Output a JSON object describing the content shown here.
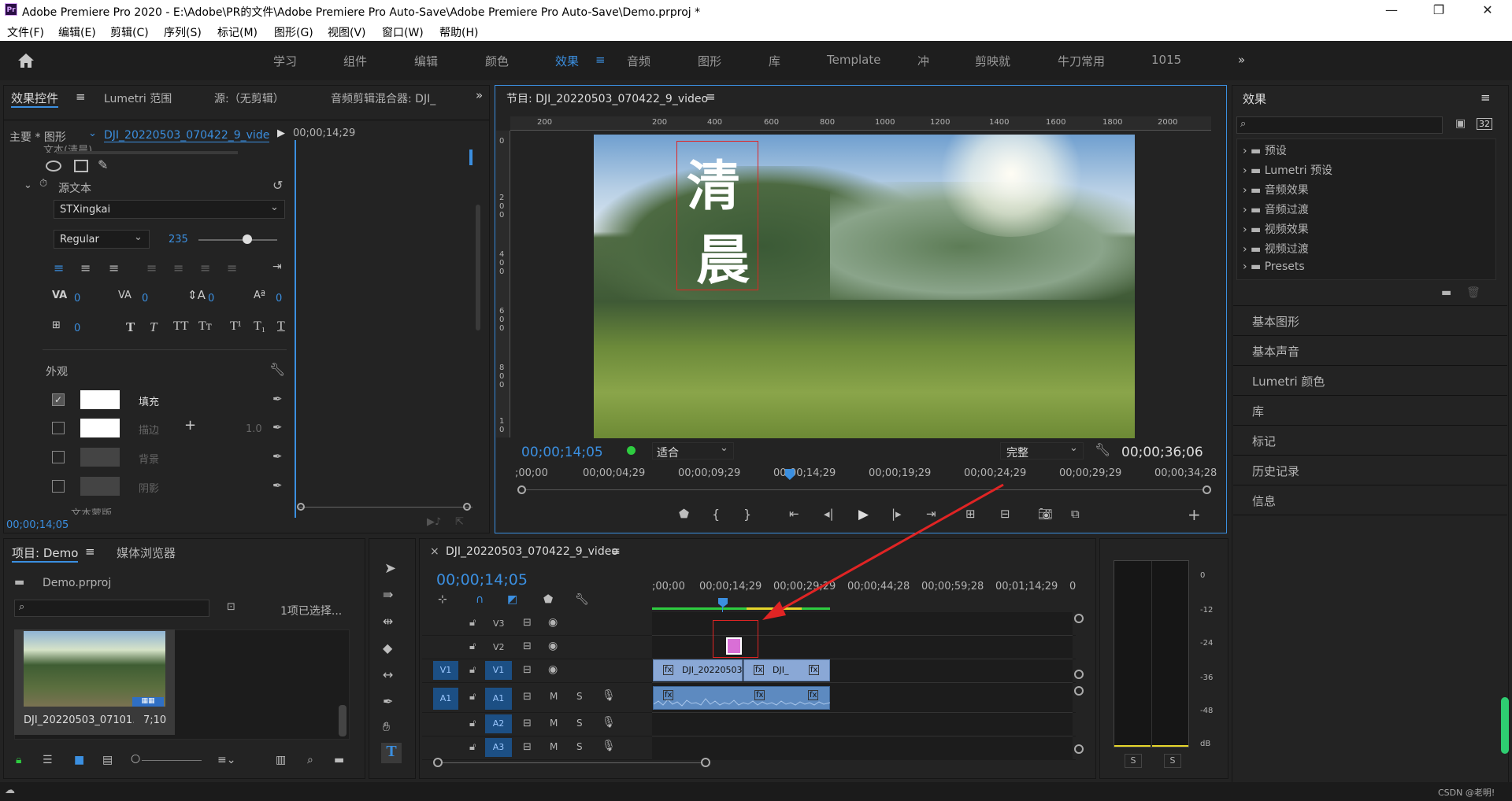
{
  "titlebar": {
    "logo": "Pr",
    "title": "Adobe Premiere Pro 2020 - E:\\Adobe\\PR的文件\\Adobe Premiere Pro Auto-Save\\Adobe Premiere Pro Auto-Save\\Demo.prproj *",
    "min": "—",
    "max": "❐",
    "close": "✕"
  },
  "menu": [
    "文件(F)",
    "编辑(E)",
    "剪辑(C)",
    "序列(S)",
    "标记(M)",
    "图形(G)",
    "视图(V)",
    "窗口(W)",
    "帮助(H)"
  ],
  "workspaces": [
    "学习",
    "组件",
    "编辑",
    "颜色",
    "效果",
    "音频",
    "图形",
    "库",
    "Template",
    "冲",
    "剪映就",
    "牛刀常用",
    "1015"
  ],
  "effect_controls": {
    "tabs": [
      "效果控件",
      "Lumetri 范围",
      "源:（无剪辑）",
      "音频剪辑混合器: DJI_"
    ],
    "menu_glyph": "≡",
    "source": "主要 * 图形",
    "clip": "DJI_20220503_070422_9_vide...",
    "ruler_time": "00;00;14;29",
    "partial_label": "文本(清晨)",
    "source_text_label": "源文本",
    "font": "STXingkai",
    "style": "Regular",
    "size": "235",
    "tracking": "0",
    "kerning": "0",
    "leading": "0",
    "baseline": "0",
    "tsume": "0",
    "appearance": "外观",
    "fill": "填充",
    "stroke": "描边",
    "stroke_width": "1.0",
    "background": "背景",
    "shadow": "阴影",
    "text_mask": "文本蒙版",
    "timecode": "00;00;14;05"
  },
  "program": {
    "title": "节目: DJI_20220503_070422_9_video",
    "menu_glyph": "≡",
    "overlay_chars": [
      "清",
      "晨"
    ],
    "ruler_h": [
      "200",
      "200",
      "400",
      "600",
      "800",
      "1000",
      "1200",
      "1400",
      "1600",
      "1800",
      "2000"
    ],
    "ruler_v": [
      "0",
      "2 0 0",
      "4 0 0",
      "6 0 0",
      "8 0 0",
      "1 0"
    ],
    "timecode": "00;00;14;05",
    "fit": "适合",
    "quality": "完整",
    "duration": "00;00;36;06",
    "scale": [
      ";00;00",
      "00;00;04;29",
      "00;00;09;29",
      "00;00;14;29",
      "00;00;19;29",
      "00;00;24;29",
      "00;00;29;29",
      "00;00;34;28"
    ],
    "playhead_fraction": 0.39
  },
  "effects": {
    "title": "效果",
    "menu_glyph": "≡",
    "badge": "32",
    "folders": [
      "预设",
      "Lumetri 预设",
      "音频效果",
      "音频过渡",
      "视频效果",
      "视频过渡",
      "Presets"
    ],
    "panels": [
      "基本图形",
      "基本声音",
      "Lumetri 颜色",
      "库",
      "标记",
      "历史记录",
      "信息"
    ]
  },
  "project": {
    "tabs": [
      "项目: Demo",
      "媒体浏览器"
    ],
    "menu_glyph": "≡",
    "file": "Demo.prproj",
    "selection": "1项已选择...",
    "clip_name": "DJI_20220503_07101...",
    "clip_dur": "7;10"
  },
  "timeline": {
    "tab": "DJI_20220503_070422_9_video",
    "close": "×",
    "menu_glyph": "≡",
    "timecode": "00;00;14;05",
    "scale": [
      ";00;00",
      "00;00;14;29",
      "00;00;29;29",
      "00;00;44;28",
      "00;00;59;28",
      "00;01;14;29",
      "0"
    ],
    "tracks": [
      {
        "name": "V3"
      },
      {
        "name": "V2"
      },
      {
        "src": "V1",
        "name": "V1"
      },
      {
        "src": "A1",
        "name": "A1"
      },
      {
        "name": "A2"
      },
      {
        "name": "A3"
      }
    ],
    "clip1": "DJI_20220503",
    "clip2": "DJI_",
    "fx": "fx",
    "m": "M",
    "s": "S"
  },
  "meter": {
    "labels": [
      "0",
      "-12",
      "-24",
      "-36",
      "-48",
      "dB"
    ],
    "solo": [
      "S",
      "S"
    ]
  },
  "status": {
    "watermark": "CSDN @老明!"
  },
  "colors": {
    "accent": "#3b8fe0",
    "highlight": "#e02424",
    "title_clip": "#d96fd6"
  }
}
